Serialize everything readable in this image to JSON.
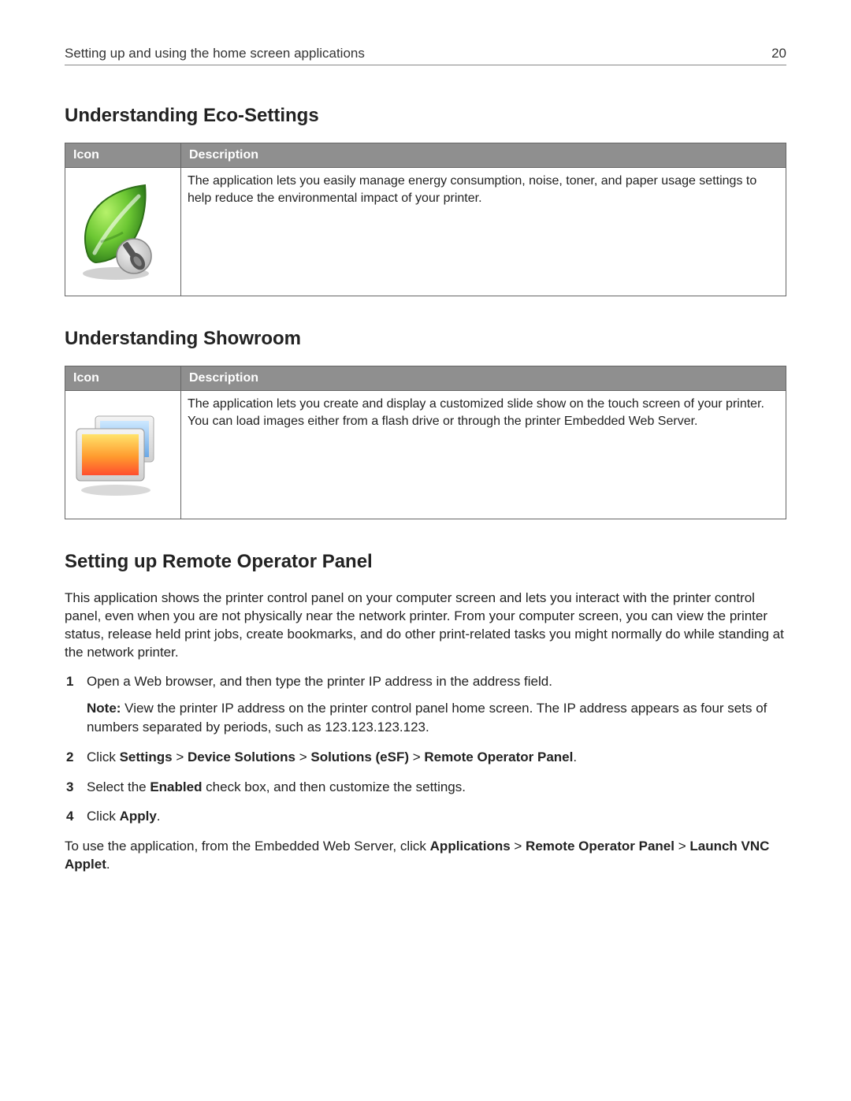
{
  "header": {
    "left": "Setting up and using the home screen applications",
    "page": "20"
  },
  "eco": {
    "heading": "Understanding Eco‑Settings",
    "table": {
      "col_icon": "Icon",
      "col_desc": "Description",
      "desc": "The application lets you easily manage energy consumption, noise, toner, and paper usage settings to help reduce the environmental impact of your printer."
    }
  },
  "showroom": {
    "heading": "Understanding Showroom",
    "table": {
      "col_icon": "Icon",
      "col_desc": "Description",
      "desc": "The application lets you create and display a customized slide show on the touch screen of your printer. You can load images either from a flash drive or through the printer Embedded Web Server."
    }
  },
  "remote": {
    "heading": "Setting up Remote Operator Panel",
    "intro": "This application shows the printer control panel on your computer screen and lets you interact with the printer control panel, even when you are not physically near the network printer. From your computer screen, you can view the printer status, release held print jobs, create bookmarks, and do other print-related tasks you might normally do while standing at the network printer.",
    "step1": "Open a Web browser, and then type the printer IP address in the address field.",
    "step1_note_label": "Note:",
    "step1_note_body": " View the printer IP address on the printer control panel home screen. The IP address appears as four sets of numbers separated by periods, such as 123.123.123.123.",
    "step2_pre": "Click ",
    "step2_b1": "Settings",
    "step2_sep": " > ",
    "step2_b2": "Device Solutions",
    "step2_b3": "Solutions (eSF)",
    "step2_b4": "Remote Operator Panel",
    "step2_end": ".",
    "step3_pre": "Select the ",
    "step3_b": "Enabled",
    "step3_post": " check box, and then customize the settings.",
    "step4_pre": "Click ",
    "step4_b": "Apply",
    "step4_end": ".",
    "outro_pre": "To use the application, from the Embedded Web Server, click ",
    "outro_b1": "Applications",
    "outro_sep": " > ",
    "outro_b2": "Remote Operator Panel",
    "outro_b3": "Launch VNC Applet",
    "outro_end": "."
  }
}
